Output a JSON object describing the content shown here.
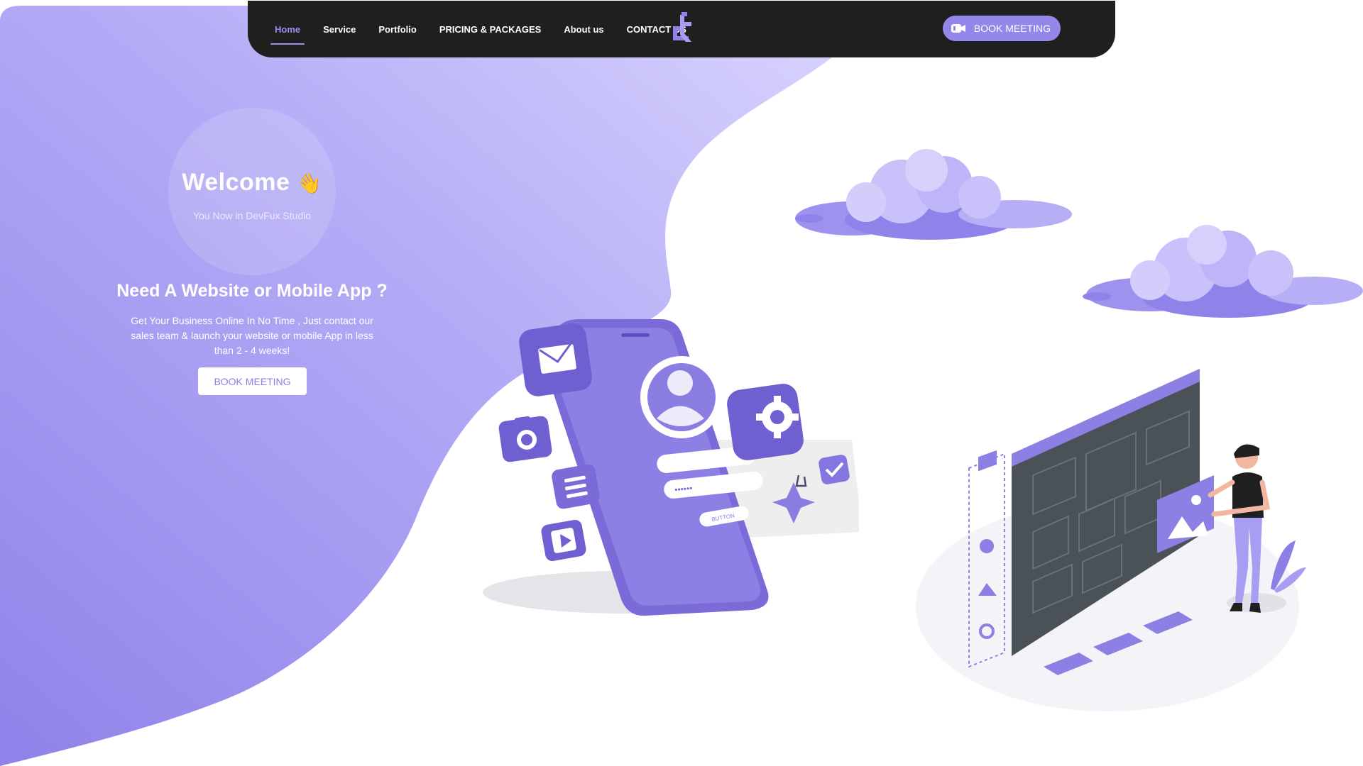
{
  "nav": {
    "links": [
      "Home",
      "Service",
      "Portfolio",
      "PRICING & PACKAGES",
      "About us",
      "CONTACT US"
    ],
    "active_link": "Home",
    "logo_icon": "devfux-logo-icon",
    "book_meeting": "BOOK MEETING",
    "book_icon": "video-camera-icon"
  },
  "hero": {
    "welcome": "Welcome",
    "wave_emoji": "👋",
    "welcome_sub": "You Now in DevFux Studio",
    "headline": "Need A Website or Mobile App ?",
    "description": "Get Your Business Online In No Time , Just contact our sales team & launch your website or mobile App in less than 2 - 4 weeks!",
    "cta": "BOOK MEETING"
  },
  "phone_ui": {
    "button_text": "BUTTON",
    "password_mask": "••••••"
  },
  "colors": {
    "accent": "#9487ea",
    "accent_dark": "#7265d4",
    "navbar_bg": "#1f1f1f",
    "hero_gradient_top": "#cdc7fb",
    "hero_gradient_bottom": "#8f83ea",
    "white": "#ffffff"
  }
}
